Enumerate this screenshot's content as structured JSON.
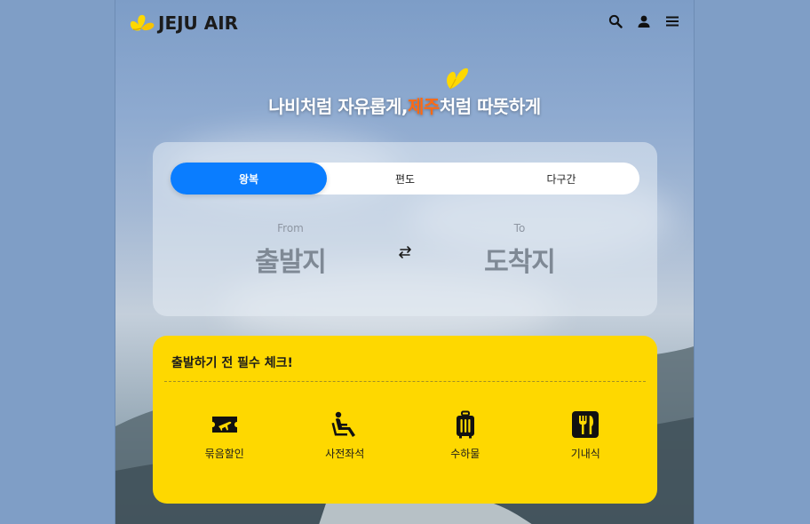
{
  "brand": {
    "logo_text": "JEJU AIR",
    "color": "#fed800"
  },
  "header": {
    "icons": [
      "search-icon",
      "user-icon",
      "menu-icon"
    ]
  },
  "hero": {
    "headline_pre": "나비처럼 자유롭게,",
    "headline_accent": "제주",
    "headline_post": "처럼 따뜻하게",
    "accent_color": "#ff6a13"
  },
  "search": {
    "tabs": [
      {
        "label": "왕복",
        "active": true
      },
      {
        "label": "편도",
        "active": false
      },
      {
        "label": "다구간",
        "active": false
      }
    ],
    "from": {
      "small": "From",
      "big": "출발지"
    },
    "to": {
      "small": "To",
      "big": "도착지"
    },
    "swap_icon": "swap-arrows-icon",
    "active_color": "#0a7dff"
  },
  "checklist": {
    "title": "출발하기 전 필수 체크!",
    "items": [
      {
        "label": "묶음할인",
        "icon": "ticket-plane-icon"
      },
      {
        "label": "사전좌석",
        "icon": "seat-icon"
      },
      {
        "label": "수하물",
        "icon": "luggage-icon"
      },
      {
        "label": "기내식",
        "icon": "meal-icon"
      }
    ]
  }
}
